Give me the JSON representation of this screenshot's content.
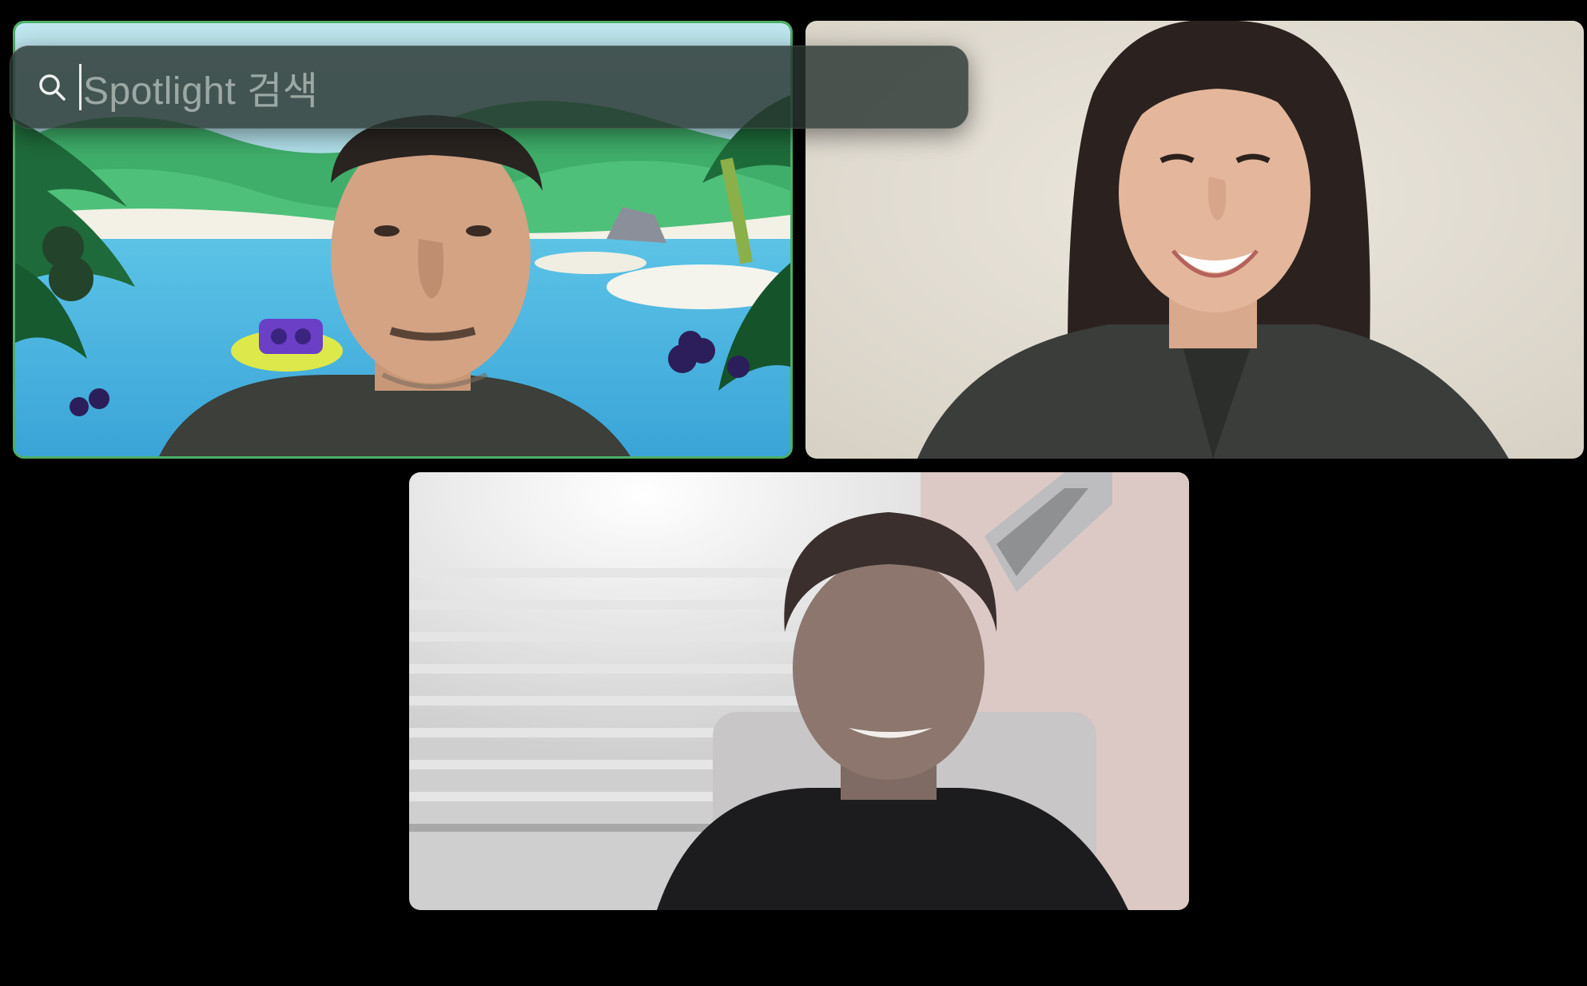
{
  "spotlight": {
    "placeholder": "Spotlight 검색",
    "icon": "search-icon"
  },
  "participants": [
    {
      "tile": "participant-tile-1",
      "active_speaker": true,
      "background": "animated-jungle-virtual-background",
      "highlight_color": "#4caf68"
    },
    {
      "tile": "participant-tile-2",
      "active_speaker": false
    },
    {
      "tile": "participant-tile-3",
      "active_speaker": false
    }
  ],
  "colors": {
    "background": "#000000",
    "active_border": "#4caf68"
  }
}
